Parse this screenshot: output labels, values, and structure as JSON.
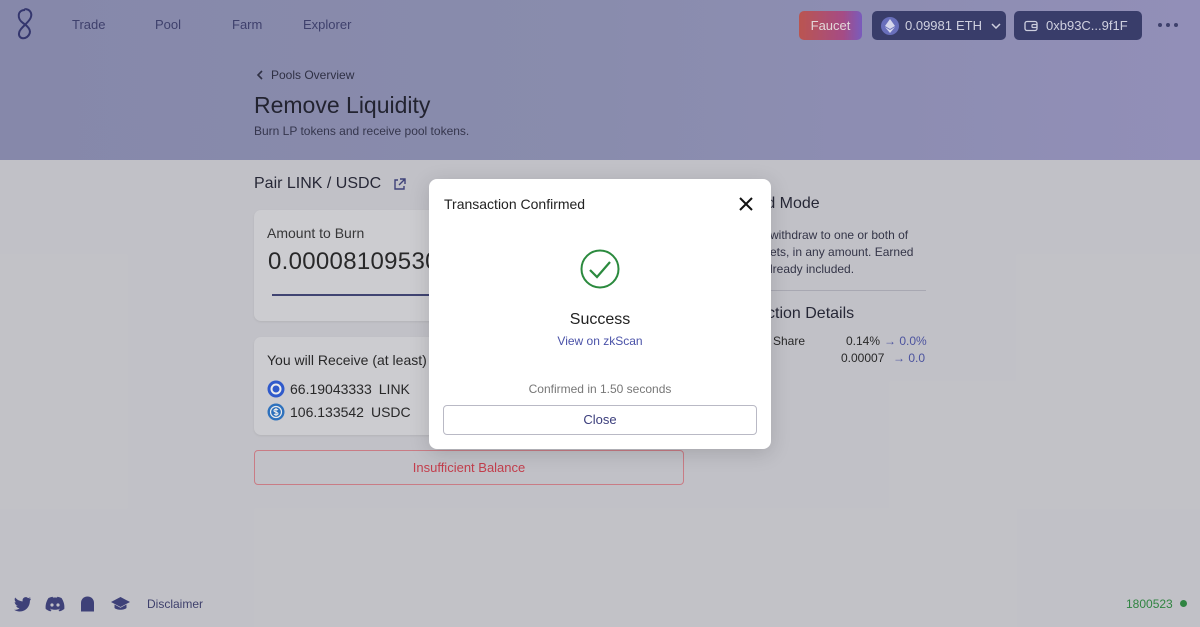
{
  "nav": {
    "links": [
      "Trade",
      "Pool",
      "Farm",
      "Explorer"
    ],
    "faucet_label": "Faucet",
    "eth_balance": "0.09981",
    "eth_symbol": "ETH",
    "wallet_address": "0xb93C...9f1F"
  },
  "header": {
    "back_label": "Pools Overview",
    "title": "Remove Liquidity",
    "subtitle": "Burn LP tokens and receive pool tokens."
  },
  "pair": {
    "title": "Pair LINK / USDC"
  },
  "burn": {
    "label": "Amount to Burn",
    "value": "0.00008109530",
    "slider_fraction": 0.5
  },
  "receive": {
    "title": "You will Receive (at least)",
    "tokens": [
      {
        "amount": "66.19043333",
        "symbol": "LINK"
      },
      {
        "amount": "106.133542",
        "symbol": "USDC"
      }
    ]
  },
  "action_button": "Insufficient Balance",
  "side": {
    "mode_heading": "rd Mode",
    "mode_lines": [
      "withdraw to one or both of",
      "ets, in any amount. Earned",
      "lready included."
    ],
    "details_heading": "ction Details",
    "share_label": "Share",
    "share_from": "0.14%",
    "share_to": "→ 0.0%",
    "lp_from": "0.00007",
    "lp_to": "→ 0.0"
  },
  "modal": {
    "title": "Transaction Confirmed",
    "status": "Success",
    "link": "View on zkScan",
    "confirmed": "Confirmed in 1.50 seconds",
    "close_label": "Close"
  },
  "footer": {
    "disclaimer": "Disclaimer",
    "block_number": "1800523",
    "icons": [
      "twitter-icon",
      "discord-icon",
      "ghost-icon",
      "graduation-cap-icon"
    ]
  },
  "colors": {
    "nav_dark": "#35396c",
    "accent_link": "#4a52a8",
    "error": "#d23b4a",
    "success_green": "#2b8a3e"
  }
}
